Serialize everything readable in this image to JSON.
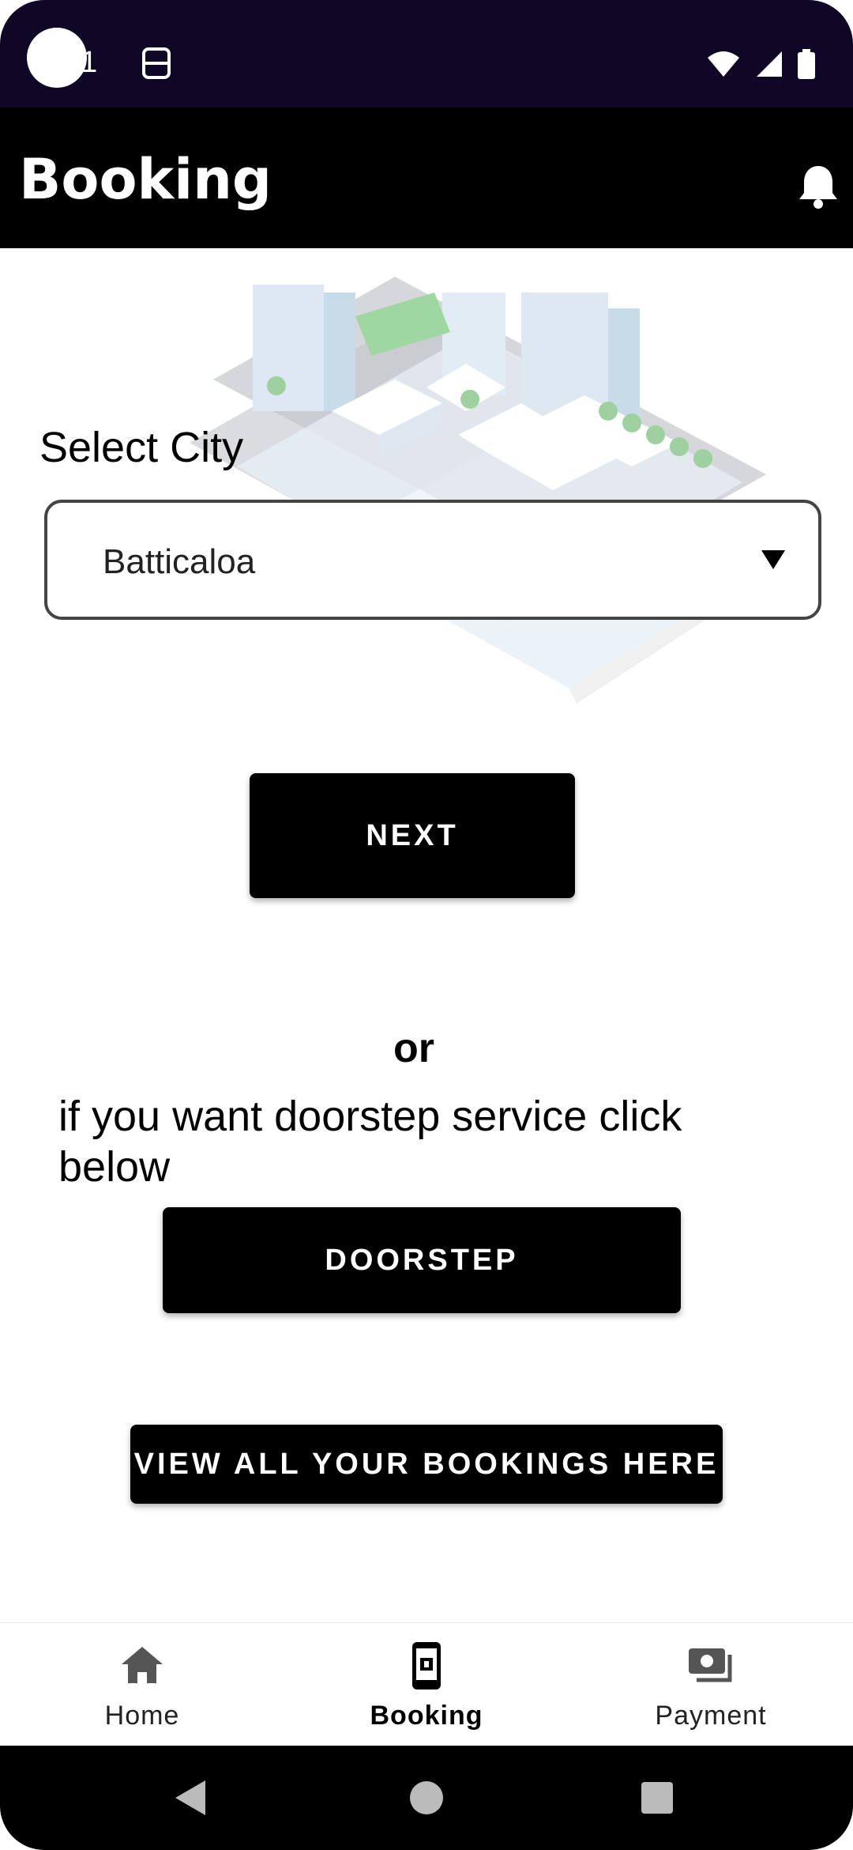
{
  "status_bar": {
    "time_partial": "01",
    "icons": [
      "sim-icon",
      "wifi-icon",
      "signal-icon",
      "battery-icon"
    ]
  },
  "app_bar": {
    "title": "Booking",
    "action_icon": "bell-icon"
  },
  "form": {
    "select_label": "Select City",
    "city_value": "Batticaloa",
    "next_label": "NEXT",
    "or_text": "or",
    "doorstep_prompt": "if you want doorstep service click below",
    "doorstep_label": "DOORSTEP",
    "view_bookings_label": "VIEW ALL YOUR BOOKINGS HERE"
  },
  "bottom_nav": {
    "items": [
      {
        "label": "Home",
        "icon": "home-icon",
        "active": false
      },
      {
        "label": "Booking",
        "icon": "booking-icon",
        "active": true
      },
      {
        "label": "Payment",
        "icon": "payment-icon",
        "active": false
      }
    ]
  },
  "colors": {
    "status_bar_bg": "#0f0725",
    "app_bar_bg": "#000000",
    "button_bg": "#000000",
    "button_text": "#ffffff"
  }
}
